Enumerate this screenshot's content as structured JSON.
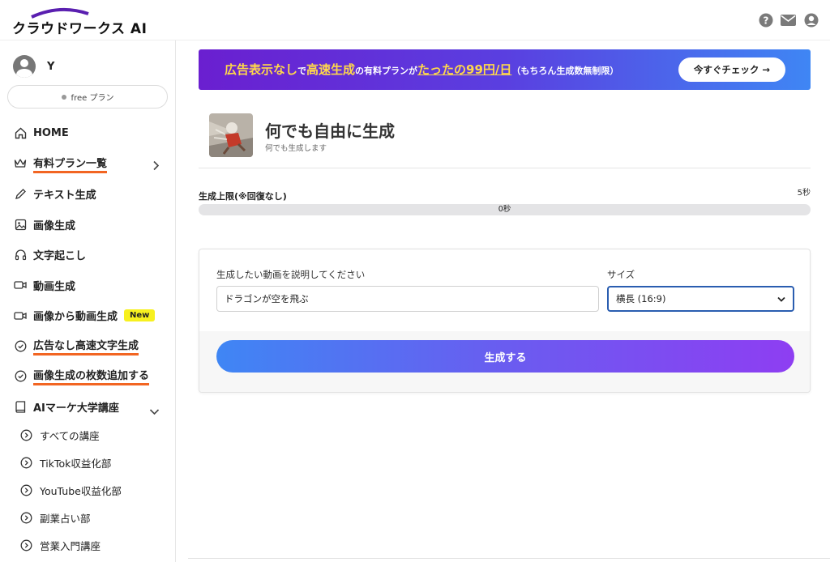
{
  "header": {
    "logo_text": "クラウドワークス AI"
  },
  "sidebar": {
    "username": "Y",
    "plan": "free プラン",
    "items": [
      {
        "label": "HOME"
      },
      {
        "label": "有料プラン一覧"
      },
      {
        "label": "テキスト生成"
      },
      {
        "label": "画像生成"
      },
      {
        "label": "文字起こし"
      },
      {
        "label": "動画生成"
      },
      {
        "label": "画像から動画生成",
        "badge": "New"
      },
      {
        "label": "広告なし高速文字生成"
      },
      {
        "label": "画像生成の枚数追加する"
      },
      {
        "label": "AIマーケ大学講座"
      }
    ],
    "sub_items": [
      {
        "label": "すべての講座"
      },
      {
        "label": "TikTok収益化部"
      },
      {
        "label": "YouTube収益化部"
      },
      {
        "label": "副業占い部"
      },
      {
        "label": "営業入門講座"
      }
    ]
  },
  "banner": {
    "part1": "広告表示なし",
    "part2": "で",
    "part3": "高速生成",
    "part4": "の有料プランが",
    "part5": "たったの99円/日",
    "part6": "（もちろん生成数無制限）",
    "button": "今すぐチェック →"
  },
  "page": {
    "title": "何でも自由に生成",
    "subtitle": "何でも生成します"
  },
  "limit": {
    "label": "生成上限(※回復なし)",
    "max": "5秒",
    "current": "0秒",
    "fraction": 0
  },
  "form": {
    "prompt_label": "生成したい動画を説明してください",
    "prompt_value": "ドラゴンが空を飛ぶ",
    "size_label": "サイズ",
    "size_value": "横長 (16:9)",
    "submit": "生成する"
  },
  "colors": {
    "accent_underline": "#f26522",
    "badge_yellow": "#f7f01f",
    "banner_yellow": "#ffd84a"
  }
}
